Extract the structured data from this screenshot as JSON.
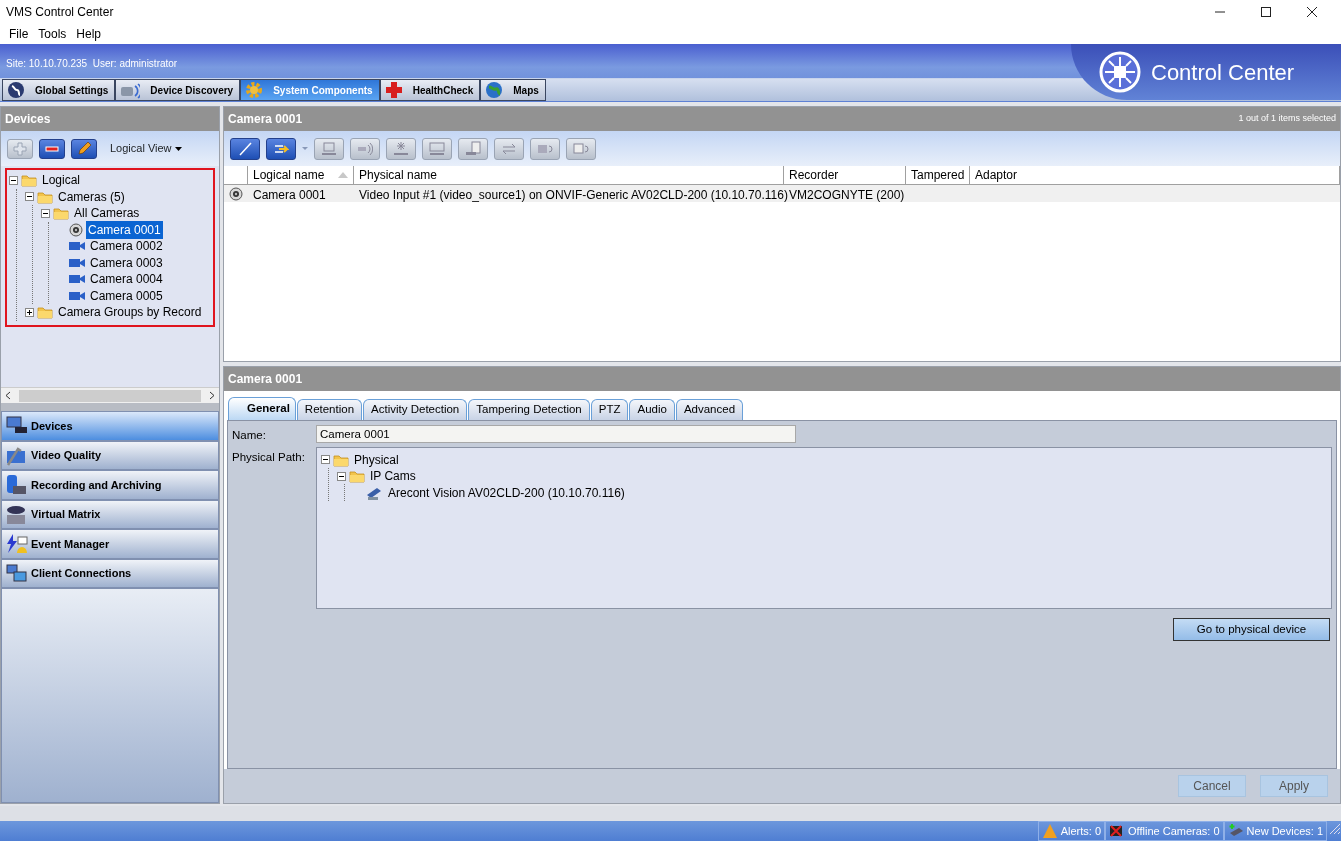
{
  "window": {
    "title": "VMS Control Center"
  },
  "menu": [
    "File",
    "Tools",
    "Help"
  ],
  "header": {
    "site_info": "Site: 10.10.70.235  User: administrator",
    "logo_text": "Control Center"
  },
  "main_tabs": [
    {
      "label": "Global Settings",
      "selected": false
    },
    {
      "label": "Device Discovery",
      "selected": false
    },
    {
      "label": "System Components",
      "selected": true
    },
    {
      "label": "HealthCheck",
      "selected": false
    },
    {
      "label": "Maps",
      "selected": false
    }
  ],
  "devices_panel": {
    "title": "Devices",
    "toolbar": [
      {
        "disabled": true
      },
      {
        "disabled": false
      },
      {
        "disabled": false
      }
    ],
    "view_menu": "Logical View",
    "tree": [
      {
        "label": "Logical",
        "kind": "folder",
        "selected": false,
        "expanded": true,
        "children": [
          {
            "label": "Cameras (5)",
            "kind": "folder",
            "selected": false,
            "expanded": true,
            "children": [
              {
                "label": "All Cameras",
                "kind": "folder",
                "selected": false,
                "expanded": true,
                "children": [
                  {
                    "label": "Camera 0001",
                    "kind": "webcam",
                    "selected": true
                  },
                  {
                    "label": "Camera 0002",
                    "kind": "camera",
                    "selected": false
                  },
                  {
                    "label": "Camera 0003",
                    "kind": "camera",
                    "selected": false
                  },
                  {
                    "label": "Camera 0004",
                    "kind": "camera",
                    "selected": false
                  },
                  {
                    "label": "Camera 0005",
                    "kind": "camera",
                    "selected": false
                  }
                ]
              }
            ]
          },
          {
            "label": "Camera Groups by Record",
            "kind": "folder",
            "selected": false,
            "expanded": false
          }
        ]
      }
    ]
  },
  "nav": [
    {
      "label": "Devices",
      "selected": true
    },
    {
      "label": "Video Quality",
      "selected": false
    },
    {
      "label": "Recording and Archiving",
      "selected": false
    },
    {
      "label": "Virtual Matrix",
      "selected": false
    },
    {
      "label": "Event Manager",
      "selected": false
    },
    {
      "label": "Client Connections",
      "selected": false
    }
  ],
  "list_panel": {
    "title": "Camera 0001",
    "selection_info": "1 out of 1 items selected",
    "toolbar": [
      {
        "disabled": false
      },
      {
        "disabled": false
      },
      {
        "disabled": true
      },
      {
        "disabled": true
      },
      {
        "disabled": true
      },
      {
        "disabled": true
      },
      {
        "disabled": true
      },
      {
        "disabled": true
      },
      {
        "disabled": true
      },
      {
        "disabled": true
      }
    ],
    "columns": [
      {
        "label": "Logical name",
        "sorted": true
      },
      {
        "label": "Physical name",
        "sorted": false
      },
      {
        "label": "Recorder",
        "sorted": false
      },
      {
        "label": "Tampered",
        "sorted": false
      },
      {
        "label": "Adaptor",
        "sorted": false
      }
    ],
    "rows": [
      {
        "logical_name": "Camera 0001",
        "physical_name": "Video Input #1 (video_source1) on ONVIF-Generic AV02CLD-200 (10.10.70.116)",
        "recorder": "VM2COGNYTE (200)",
        "selected": false
      }
    ]
  },
  "properties": {
    "title": "Camera 0001",
    "tabs": [
      {
        "label": "General",
        "selected": true
      },
      {
        "label": "Retention",
        "selected": false
      },
      {
        "label": "Activity Detection",
        "selected": false
      },
      {
        "label": "Tampering Detection",
        "selected": false
      },
      {
        "label": "PTZ",
        "selected": false
      },
      {
        "label": "Audio",
        "selected": false
      },
      {
        "label": "Advanced",
        "selected": false
      }
    ],
    "name_label": "Name:",
    "name_value": "Camera 0001",
    "path_label": "Physical Path:",
    "path_tree": [
      {
        "label": "Physical",
        "kind": "folder",
        "expanded": true,
        "children": [
          {
            "label": "IP Cams",
            "kind": "folder",
            "expanded": true,
            "children": [
              {
                "label": "Arecont Vision AV02CLD-200 (10.10.70.116)",
                "kind": "device"
              }
            ]
          }
        ]
      }
    ],
    "goto_button": "Go to physical device"
  },
  "buttons": [
    {
      "label": "Cancel",
      "disabled": true
    },
    {
      "label": "Apply",
      "disabled": true
    }
  ],
  "status_bar": [
    {
      "label": "Alerts: 0"
    },
    {
      "label": "Offline Cameras: 0"
    },
    {
      "label": "New Devices: 1"
    }
  ]
}
